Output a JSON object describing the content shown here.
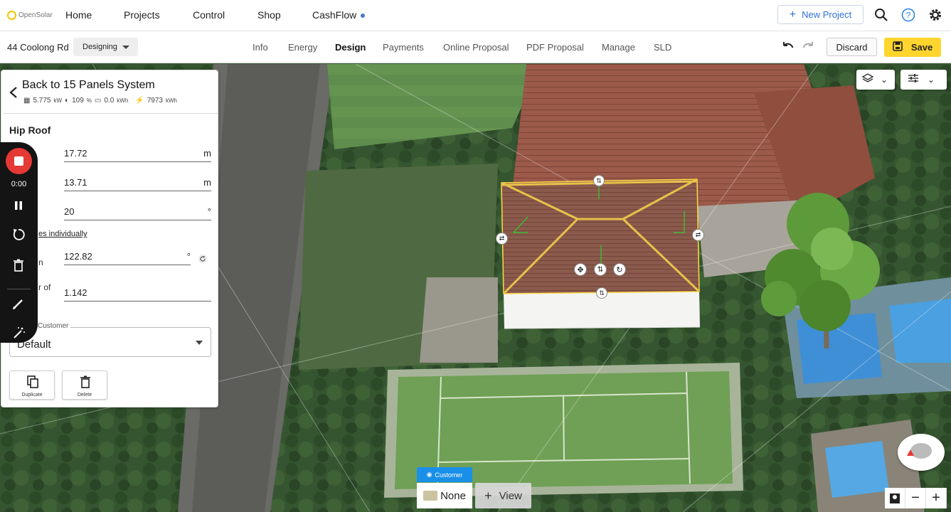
{
  "brand": {
    "name": "OpenSolar"
  },
  "nav": {
    "home": "Home",
    "projects": "Projects",
    "control": "Control",
    "shop": "Shop",
    "cashflow": "CashFlow",
    "new_project": "New Project"
  },
  "project": {
    "address": "44 Coolong Rd",
    "status": "Designing"
  },
  "tabs": [
    "Info",
    "Energy",
    "Design",
    "Payments",
    "Online Proposal",
    "PDF Proposal",
    "Manage",
    "SLD"
  ],
  "active_tab": "Design",
  "actions": {
    "discard": "Discard",
    "save": "Save"
  },
  "panel": {
    "title": "Back to 15 Panels System",
    "stats": {
      "kw": "5.775",
      "kw_unit": "kW",
      "offset": "109",
      "offset_unit": "%",
      "battery": "0.0",
      "battery_unit": "kWh",
      "production": "7973",
      "production_unit": "kWh"
    },
    "section": "Hip Roof",
    "fields": {
      "length": {
        "value": "17.72",
        "unit": "m"
      },
      "width": {
        "value": "13.71",
        "unit": "m"
      },
      "slope": {
        "value": "20",
        "unit": "°"
      },
      "slopes_link": "es individually",
      "azimuth": {
        "label": "n",
        "value": "122.82",
        "unit": "°"
      },
      "factor": {
        "label": "r of",
        "value": "1.142"
      }
    },
    "select": {
      "legend": "Customer",
      "value": "Default"
    },
    "buttons": {
      "duplicate": "Duplicate",
      "delete": "Delete"
    }
  },
  "recorder": {
    "time": "0:00"
  },
  "view_bar": {
    "tab": "Customer",
    "none": "None",
    "view": "View"
  },
  "colors": {
    "accent": "#2f6fd6",
    "save": "#ffd52e",
    "record": "#e53935",
    "customer_tab": "#1a8fe8"
  }
}
